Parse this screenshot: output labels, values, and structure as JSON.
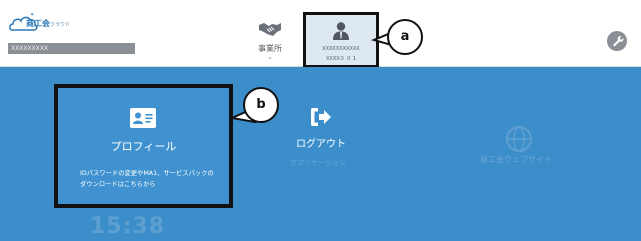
{
  "header": {
    "logo_text": "商工会",
    "logo_sub": "クラウド",
    "org_name": "XXXXXXXXX",
    "nav": {
      "office_label": "事業所",
      "user_name": "XXXXXXXXXXX",
      "user_id": "XXXX０ ０ 1"
    }
  },
  "main": {
    "profile": {
      "title": "プロフィール",
      "description": "IDパスワードの変更やMA1、サービスパックのダウンロードはこちらから"
    },
    "logout": {
      "title": "ログアウト"
    },
    "faded": {
      "left_text": "アプリケーション",
      "right_text": "商工会ウェブサイト",
      "clock": "15:38"
    }
  },
  "callouts": {
    "a": "a",
    "b": "b"
  },
  "colors": {
    "main_background": "#3c8ecb",
    "header_background": "#ffffff",
    "highlight_border": "#111111"
  },
  "icons": [
    "cloud-logo-icon",
    "handshake-icon",
    "user-icon",
    "wrench-icon",
    "id-card-icon",
    "logout-arrow-icon",
    "globe-icon"
  ]
}
